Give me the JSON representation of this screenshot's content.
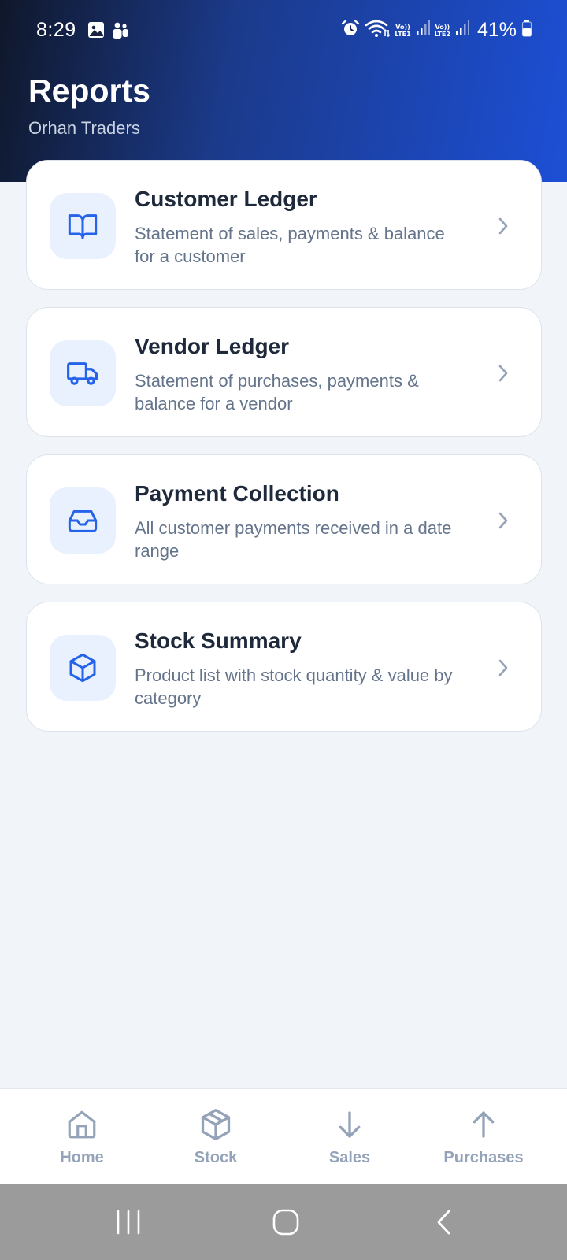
{
  "status_bar": {
    "time": "8:29",
    "battery": "41%",
    "sim1_label_top": "Vo))",
    "sim1_label_bottom": "LTE1",
    "sim2_label_top": "Vo))",
    "sim2_label_bottom": "LTE2",
    "icons": [
      "gallery-icon",
      "teams-icon",
      "alarm-icon",
      "wifi-icon",
      "signal-icon",
      "battery-icon"
    ]
  },
  "header": {
    "title": "Reports",
    "subtitle": "Orhan Traders"
  },
  "reports": [
    {
      "icon": "book-open-icon",
      "title": "Customer Ledger",
      "description": "Statement of sales, payments & balance for a customer"
    },
    {
      "icon": "truck-icon",
      "title": "Vendor Ledger",
      "description": "Statement of purchases, payments & balance for a vendor"
    },
    {
      "icon": "inbox-icon",
      "title": "Payment Collection",
      "description": "All customer payments received in a date range"
    },
    {
      "icon": "box-icon",
      "title": "Stock Summary",
      "description": "Product list with stock quantity & value by category"
    }
  ],
  "bottom_nav": [
    {
      "icon": "home-icon",
      "label": "Home"
    },
    {
      "icon": "box-icon",
      "label": "Stock"
    },
    {
      "icon": "arrow-down-icon",
      "label": "Sales"
    },
    {
      "icon": "arrow-up-icon",
      "label": "Purchases"
    }
  ],
  "colors": {
    "accent": "#2563eb",
    "icon_bg": "#e9f1fe",
    "title_text": "#1e293b",
    "muted_text": "#64748b",
    "nav_inactive": "#94a3b8",
    "page_bg": "#f1f5fa"
  }
}
